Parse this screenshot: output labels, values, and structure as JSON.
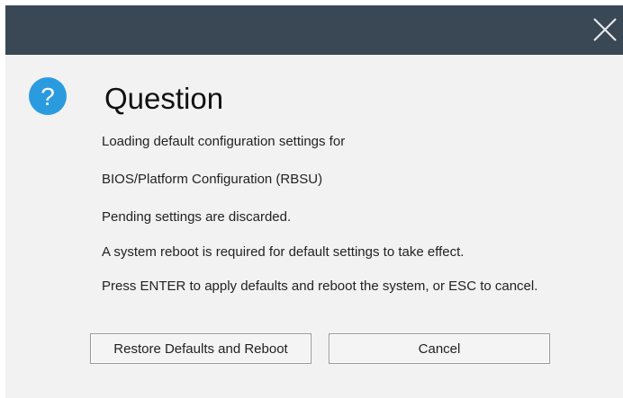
{
  "dialog": {
    "title": "Question",
    "icon": "question-icon",
    "accent_color": "#2b9be0",
    "titlebar_color": "#3a4754",
    "close_icon": "close-icon",
    "messages": [
      "Loading default configuration settings for",
      "BIOS/Platform Configuration (RBSU)",
      "Pending settings are discarded.",
      "A system reboot is required for default settings to take effect.",
      "Press ENTER to apply defaults and reboot the system, or ESC to cancel."
    ],
    "buttons": {
      "restore_label": "Restore Defaults and Reboot",
      "cancel_label": "Cancel"
    }
  }
}
